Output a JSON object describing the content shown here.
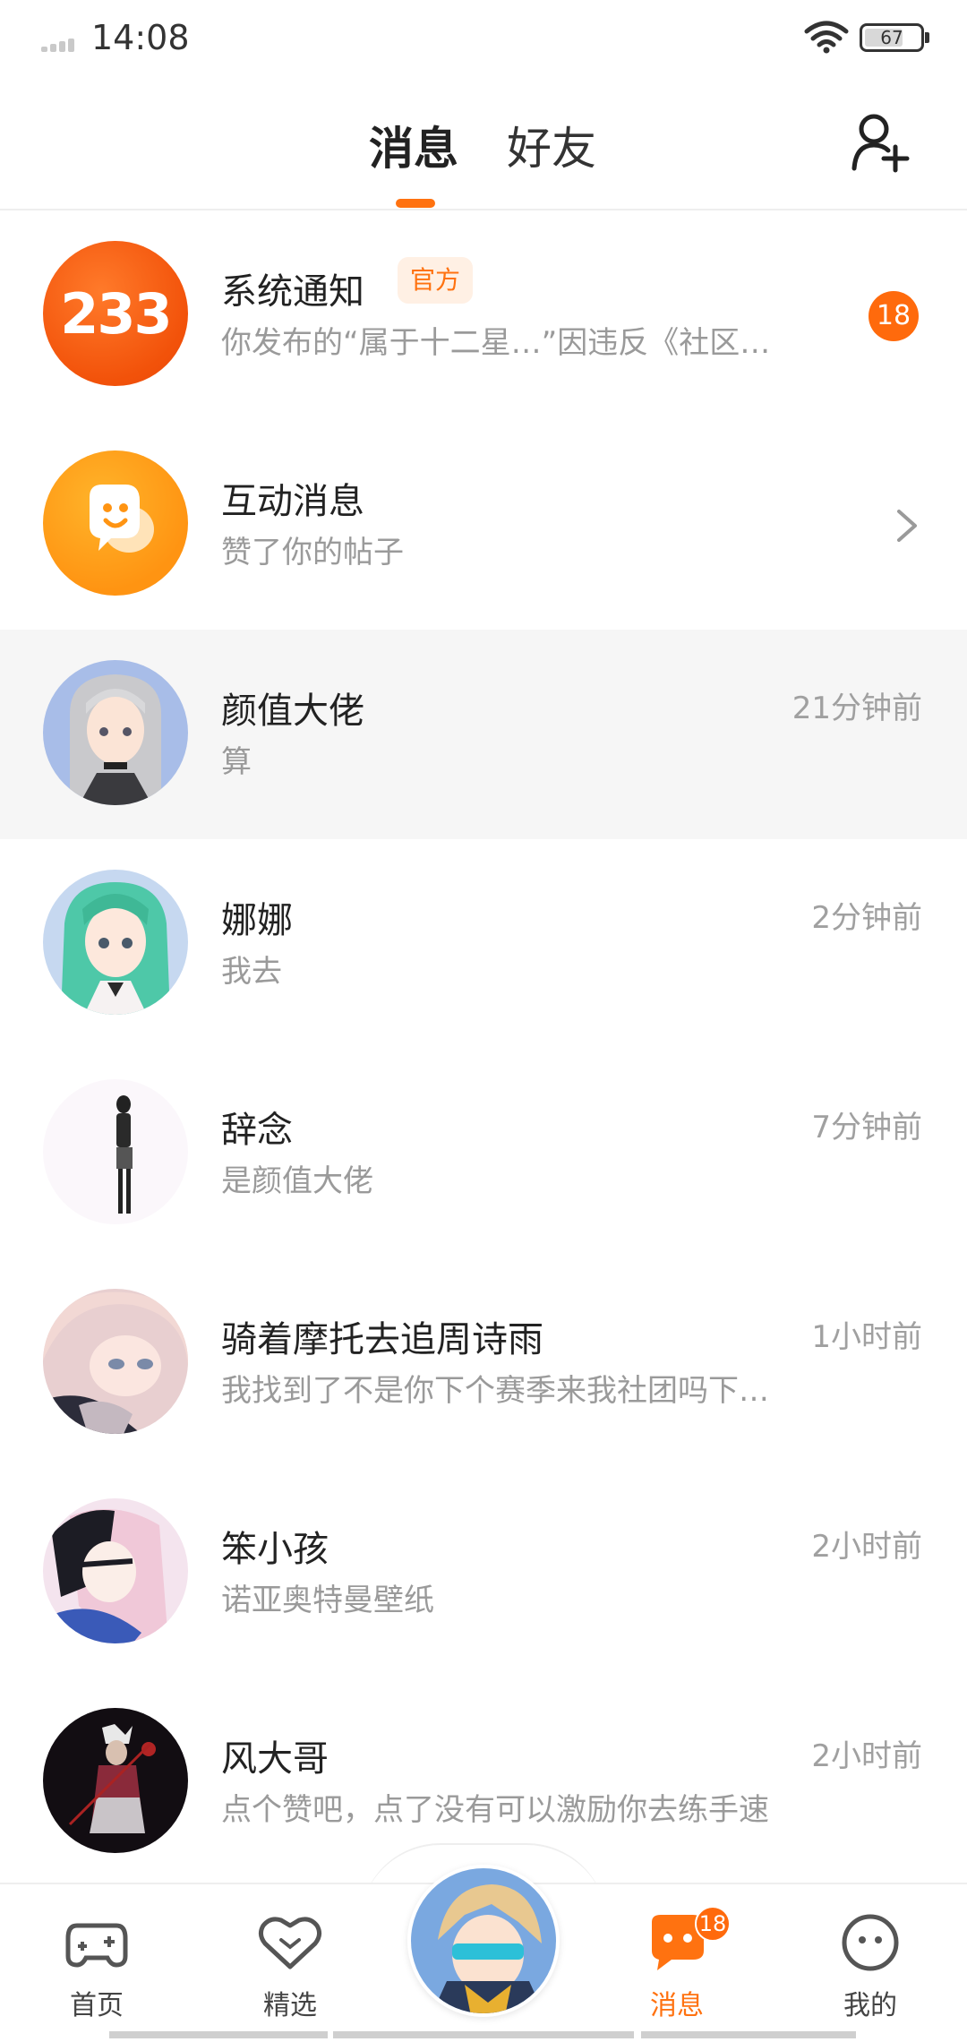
{
  "status_bar": {
    "time": "14:08",
    "battery": "67"
  },
  "header": {
    "tab_messages": "消息",
    "tab_friends": "好友"
  },
  "rows": [
    {
      "title": "系统通知",
      "tag": "官方",
      "subtitle": "你发布的“属于十二星…”因违反《社区…",
      "badge": "18",
      "avatar_text": "233"
    },
    {
      "title": "互动消息",
      "subtitle": "赞了你的帖子"
    },
    {
      "title": "颜值大佬",
      "subtitle": "算",
      "time": "21分钟前"
    },
    {
      "title": "娜娜",
      "subtitle": "我去",
      "time": "2分钟前"
    },
    {
      "title": "辞念",
      "subtitle": "是颜值大佬",
      "time": "7分钟前"
    },
    {
      "title": "骑着摩托去追周诗雨",
      "subtitle": "我找到了不是你下个赛季来我社团吗下…",
      "time": "1小时前"
    },
    {
      "title": "笨小孩",
      "subtitle": "诺亚奥特曼壁纸",
      "time": "2小时前"
    },
    {
      "title": "风大哥",
      "subtitle": "点个赞吧，点了没有可以激励你去练手速",
      "time": "2小时前"
    }
  ],
  "bottom_nav": {
    "home": "首页",
    "featured": "精选",
    "messages": "消息",
    "messages_badge": "18",
    "mine": "我的"
  },
  "colors": {
    "accent": "#ff7210",
    "badge": "#ff6a0c"
  }
}
